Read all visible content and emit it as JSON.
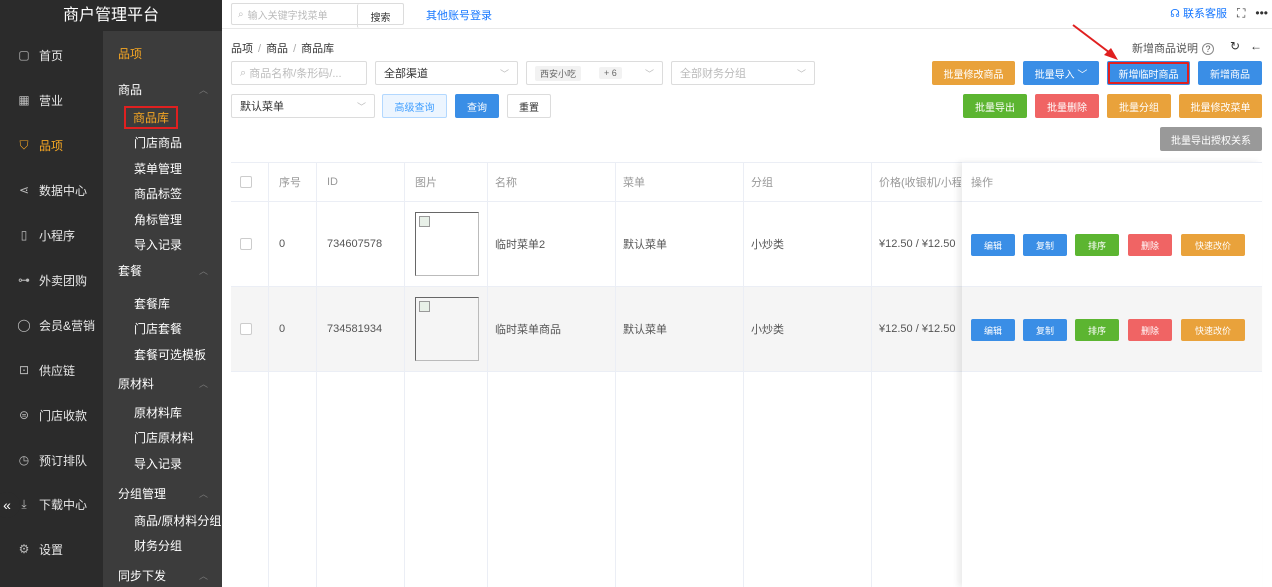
{
  "app": {
    "title": "商户管理平台"
  },
  "topbar": {
    "search_placeholder": "输入关键字找菜单",
    "search_button": "搜索",
    "other_login": "其他账号登录",
    "contact_service": "联系客服"
  },
  "nav_main": [
    {
      "label": "首页",
      "icon": "home-icon"
    },
    {
      "label": "营业",
      "icon": "calendar-icon"
    },
    {
      "label": "品项",
      "icon": "bag-icon",
      "active": true
    },
    {
      "label": "数据中心",
      "icon": "share-icon"
    },
    {
      "label": "小程序",
      "icon": "phone-icon"
    },
    {
      "label": "外卖团购",
      "icon": "bike-icon"
    },
    {
      "label": "会员&营销",
      "icon": "user-icon"
    },
    {
      "label": "供应链",
      "icon": "truck-icon"
    },
    {
      "label": "门店收款",
      "icon": "coins-icon"
    },
    {
      "label": "预订排队",
      "icon": "clock-icon"
    },
    {
      "label": "下载中心",
      "icon": "download-icon"
    },
    {
      "label": "设置",
      "icon": "gear-icon"
    }
  ],
  "nav_sub": {
    "title": "品项",
    "groups": [
      {
        "label": "商品",
        "items": [
          "商品库",
          "门店商品",
          "菜单管理",
          "商品标签",
          "角标管理",
          "导入记录"
        ]
      },
      {
        "label": "套餐",
        "items": [
          "套餐库",
          "门店套餐",
          "套餐可选模板"
        ]
      },
      {
        "label": "原材料",
        "items": [
          "原材料库",
          "门店原材料",
          "导入记录"
        ]
      },
      {
        "label": "分组管理",
        "items": [
          "商品/原材料分组",
          "财务分组"
        ]
      },
      {
        "label": "同步下发",
        "items": []
      }
    ]
  },
  "breadcrumb": {
    "p1": "品项",
    "p2": "商品",
    "p3": "商品库"
  },
  "help_text": "新增商品说明",
  "filters": {
    "name_placeholder": "商品名称/条形码/...",
    "channel": "全部渠道",
    "store_tag": "西安小吃",
    "store_more": "+ 6",
    "finance_placeholder": "全部财务分组",
    "menu": "默认菜单",
    "advanced": "高级查询",
    "query": "查询",
    "reset": "重置"
  },
  "actions": {
    "batch_edit": "批量修改商品",
    "batch_import": "批量导入",
    "add_temp": "新增临时商品",
    "add_product": "新增商品",
    "batch_export": "批量导出",
    "batch_delete": "批量删除",
    "batch_group": "批量分组",
    "batch_edit_menu": "批量修改菜单",
    "batch_export_auth": "批量导出授权关系"
  },
  "table": {
    "headers": {
      "index": "序号",
      "id": "ID",
      "image": "图片",
      "name": "名称",
      "menu": "菜单",
      "group": "分组",
      "price": "价格(收银机/小程序)",
      "ops": "操作"
    },
    "rows": [
      {
        "index": "0",
        "id": "734607578",
        "name": "临时菜单2",
        "menu": "默认菜单",
        "group": "小炒类",
        "price": "¥12.50 / ¥12.50"
      },
      {
        "index": "0",
        "id": "734581934",
        "name": "临时菜单商品",
        "menu": "默认菜单",
        "group": "小炒类",
        "price": "¥12.50 / ¥12.50"
      }
    ],
    "row_ops": {
      "edit": "编辑",
      "copy": "复制",
      "sort": "排序",
      "delete": "删除",
      "quick_price": "快速改价"
    }
  }
}
